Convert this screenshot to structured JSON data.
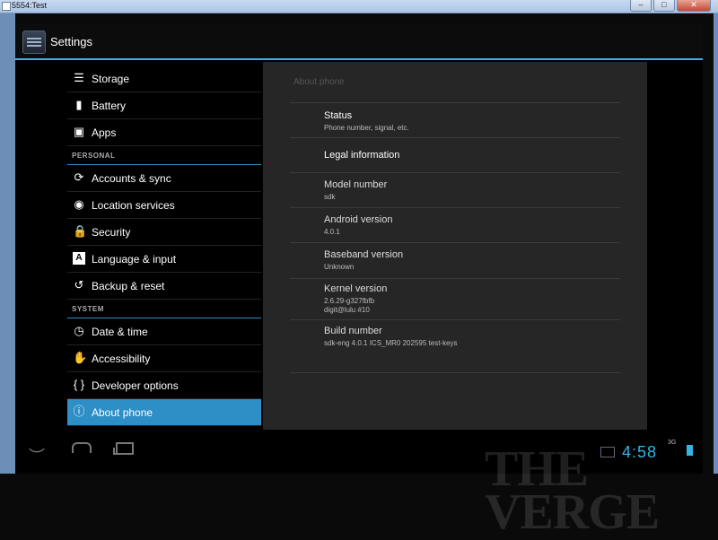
{
  "window": {
    "title": "5554:Test",
    "min_glyph": "–",
    "max_glyph": "□",
    "close_glyph": "✕"
  },
  "actionbar": {
    "title": "Settings"
  },
  "menu": {
    "items_top": [
      {
        "label": "Storage",
        "icon": "storage-icon"
      },
      {
        "label": "Battery",
        "icon": "battery-icon"
      },
      {
        "label": "Apps",
        "icon": "apps-icon"
      }
    ],
    "section_personal": "PERSONAL",
    "items_personal": [
      {
        "label": "Accounts & sync",
        "icon": "sync-icon"
      },
      {
        "label": "Location services",
        "icon": "location-icon"
      },
      {
        "label": "Security",
        "icon": "lock-icon"
      },
      {
        "label": "Language & input",
        "icon": "language-icon"
      },
      {
        "label": "Backup & reset",
        "icon": "backup-icon"
      }
    ],
    "section_system": "SYSTEM",
    "items_system": [
      {
        "label": "Date & time",
        "icon": "clock-icon"
      },
      {
        "label": "Accessibility",
        "icon": "hand-icon"
      },
      {
        "label": "Developer options",
        "icon": "braces-icon"
      },
      {
        "label": "About phone",
        "icon": "info-icon",
        "selected": true
      }
    ]
  },
  "pane": {
    "header": "About phone",
    "items": [
      {
        "title": "Status",
        "summary": "Phone number, signal, etc."
      },
      {
        "title": "Legal information"
      },
      {
        "title": "Model number",
        "summary": "sdk"
      },
      {
        "title": "Android version",
        "summary": "4.0.1"
      },
      {
        "title": "Baseband version",
        "summary": "Unknown"
      },
      {
        "title": "Kernel version",
        "summary": "2.6.29-g327fbfb",
        "summary2": "digit@lulu #10"
      },
      {
        "title": "Build number",
        "summary": "sdk-eng 4.0.1 ICS_MR0 202595 test-keys"
      }
    ]
  },
  "navbar": {
    "watermark": "THE VERGE",
    "clock": "4:58",
    "network": "3G"
  },
  "colors": {
    "accent": "#33b5e5",
    "selected": "#2e8ec6",
    "pane": "#262626"
  }
}
